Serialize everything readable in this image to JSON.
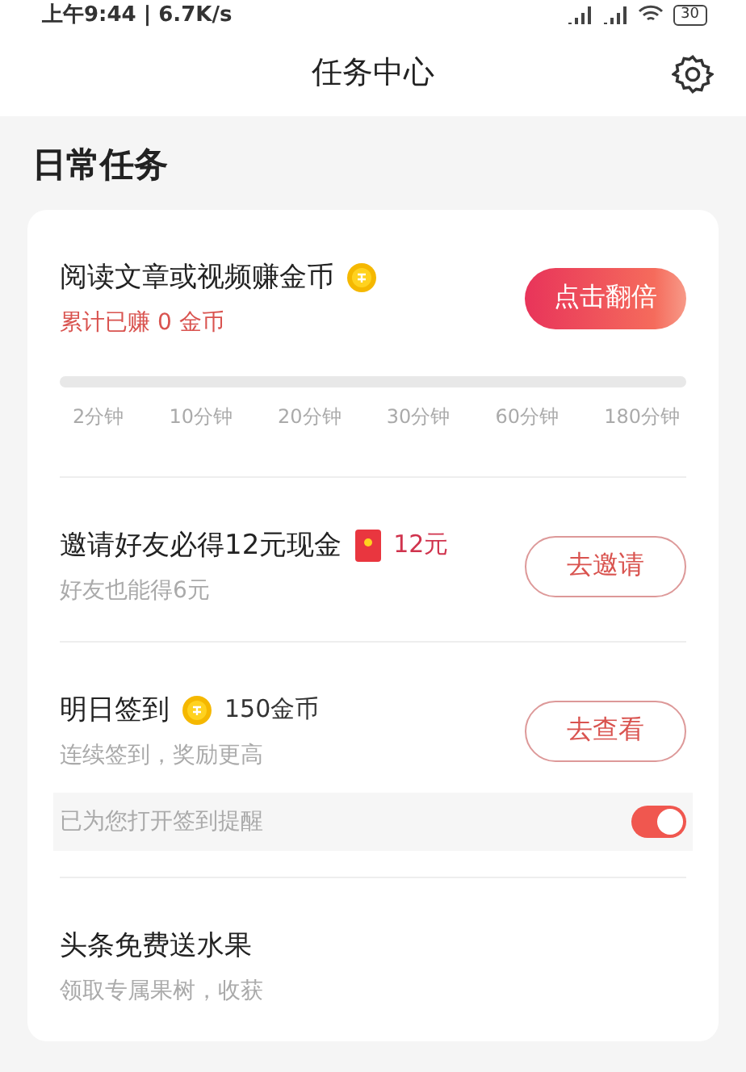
{
  "status_bar": {
    "time": "上午9:44 | 6.7K/s",
    "battery": "30"
  },
  "header": {
    "title": "任务中心"
  },
  "section": {
    "title": "日常任务"
  },
  "tasks": [
    {
      "kind": "progress",
      "title": "阅读文章或视频赚金币",
      "subtitle": "累计已赚 0 金币",
      "button": "点击翻倍",
      "progress": {
        "ticks": [
          "2分钟",
          "10分钟",
          "20分钟",
          "30分钟",
          "60分钟",
          "180分钟"
        ]
      }
    },
    {
      "kind": "invite",
      "title": "邀请好友必得12元现金",
      "reward": "12元",
      "subtitle": "好友也能得6元",
      "button": "去邀请"
    },
    {
      "kind": "checkin",
      "title": "明日签到",
      "reward": "150金币",
      "subtitle": "连续签到，奖励更高",
      "button": "去查看",
      "reminder": {
        "text": "已为您打开签到提醒",
        "on": true
      }
    },
    {
      "kind": "plain",
      "title": "头条免费送水果",
      "subtitle": "领取专属果树，收获"
    }
  ]
}
